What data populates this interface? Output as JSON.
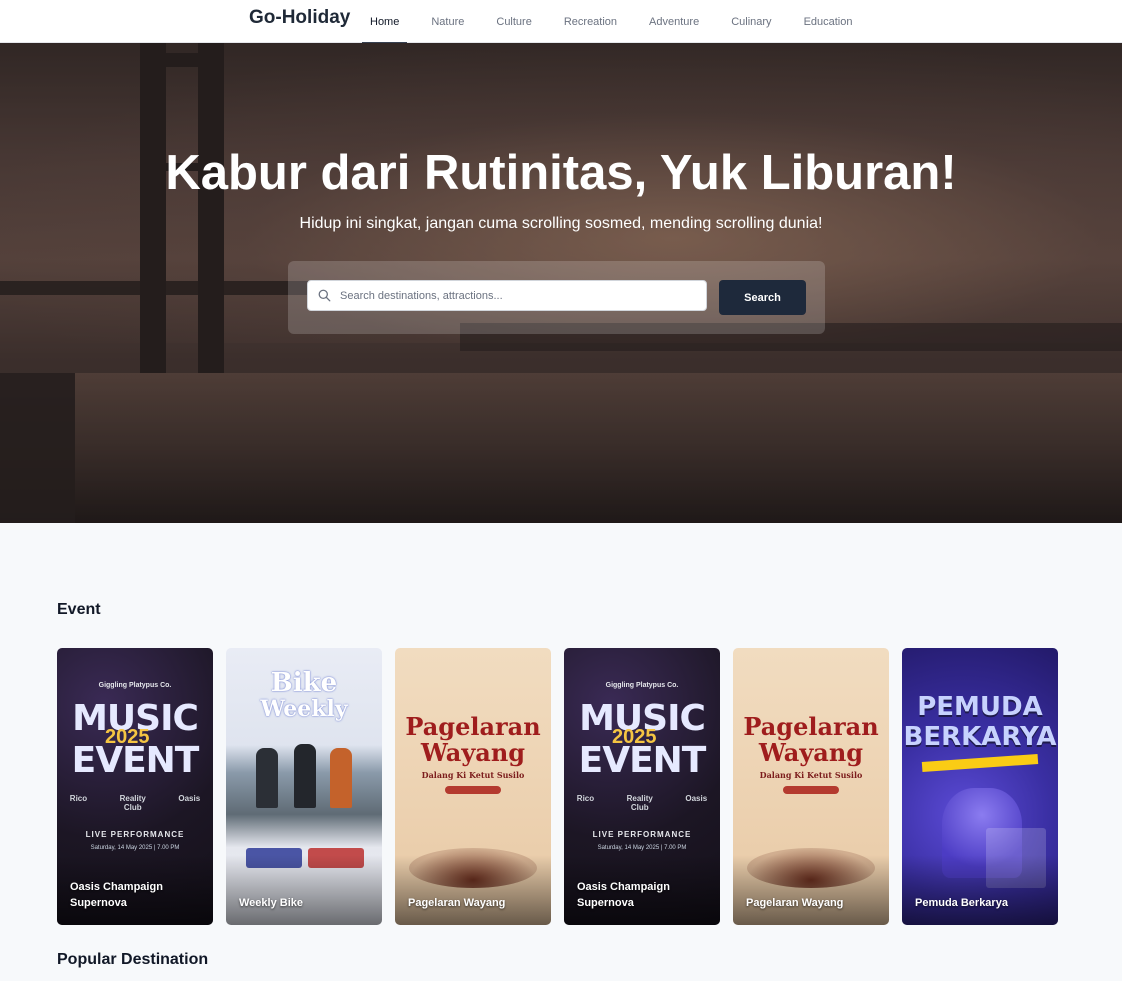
{
  "brand": "Go-Holiday",
  "nav": {
    "items": [
      "Home",
      "Nature",
      "Culture",
      "Recreation",
      "Adventure",
      "Culinary",
      "Education"
    ],
    "active": "Home"
  },
  "hero": {
    "title": "Kabur dari Rutinitas, Yuk Liburan!",
    "subtitle": "Hidup ini singkat, jangan cuma scrolling sosmed, mending scrolling dunia!",
    "search_placeholder": "Search destinations, attractions...",
    "search_button": "Search"
  },
  "events": {
    "title": "Event",
    "cards": [
      {
        "caption": "Oasis Champaign Supernova",
        "poster": "music",
        "brand": "Giggling Platypus Co.",
        "headline": "MUSIC",
        "year": "2025",
        "headline2": "EVENT",
        "acts": [
          "Rico",
          "Reality Club",
          "Oasis"
        ],
        "tag": "LIVE PERFORMANCE",
        "date": "Saturday, 14 May 2025 | 7.00 PM"
      },
      {
        "caption": "Weekly Bike",
        "poster": "bike",
        "headline": "Bike",
        "headline2": "Weekly"
      },
      {
        "caption": "Pagelaran Wayang",
        "poster": "wayang",
        "headline": "Pagelaran",
        "headline2": "Wayang",
        "sub": "Dalang Ki Ketut Susilo"
      },
      {
        "caption": "Oasis Champaign Supernova",
        "poster": "music",
        "brand": "Giggling Platypus Co.",
        "headline": "MUSIC",
        "year": "2025",
        "headline2": "EVENT",
        "acts": [
          "Rico",
          "Reality Club",
          "Oasis"
        ],
        "tag": "LIVE PERFORMANCE",
        "date": "Saturday, 14 May 2025 | 7.00 PM"
      },
      {
        "caption": "Pagelaran Wayang",
        "poster": "wayang",
        "headline": "Pagelaran",
        "headline2": "Wayang",
        "sub": "Dalang Ki Ketut Susilo"
      },
      {
        "caption": "Pemuda Berkarya",
        "poster": "pemuda",
        "headline": "PEMUDA",
        "headline2": "BERKARYA"
      }
    ]
  },
  "popular": {
    "title": "Popular Destination"
  },
  "colors": {
    "nav_active_underline": "#374151",
    "search_button": "#1e293b",
    "page_bg": "#f7f9fb"
  }
}
